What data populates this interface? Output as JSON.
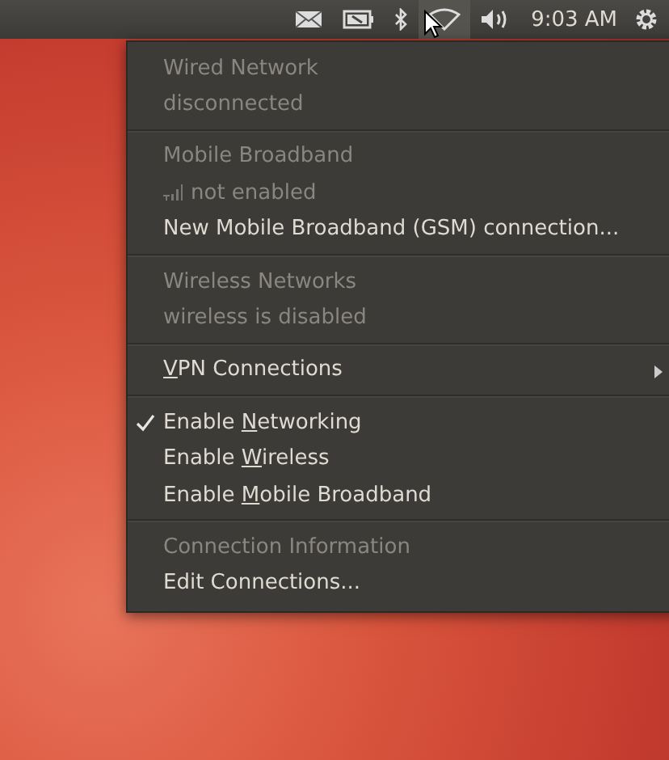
{
  "panel": {
    "indicators": [
      {
        "kind": "mail",
        "selected": false
      },
      {
        "kind": "battery",
        "selected": false
      },
      {
        "kind": "bluetooth",
        "selected": false
      },
      {
        "kind": "wifi",
        "selected": true
      },
      {
        "kind": "volume",
        "selected": false
      }
    ],
    "clock": "9:03 AM"
  },
  "menu": [
    {
      "kind": "label",
      "label": [
        "Wired Network"
      ]
    },
    {
      "kind": "label",
      "label": [
        "disconnected"
      ]
    },
    {
      "kind": "separator"
    },
    {
      "kind": "label",
      "label": [
        "Mobile Broadband"
      ]
    },
    {
      "kind": "signal",
      "label": [
        "not enabled"
      ]
    },
    {
      "kind": "item",
      "label": [
        "New Mobile Broadband (GSM) connection..."
      ]
    },
    {
      "kind": "separator"
    },
    {
      "kind": "label",
      "label": [
        "Wireless Networks"
      ]
    },
    {
      "kind": "label",
      "label": [
        "wireless is disabled"
      ]
    },
    {
      "kind": "separator"
    },
    {
      "kind": "submenu",
      "label": [
        "V",
        "PN Connections"
      ],
      "mnemonic_first": true
    },
    {
      "kind": "separator"
    },
    {
      "kind": "check",
      "checked": true,
      "label": [
        "Enable ",
        "N",
        "etworking"
      ]
    },
    {
      "kind": "check",
      "checked": false,
      "label": [
        "Enable ",
        "W",
        "ireless"
      ]
    },
    {
      "kind": "check",
      "checked": false,
      "label": [
        "Enable ",
        "M",
        "obile Broadband"
      ]
    },
    {
      "kind": "separator"
    },
    {
      "kind": "label",
      "label": [
        "Connection Information"
      ]
    },
    {
      "kind": "item",
      "label": [
        "Edit Connections..."
      ]
    }
  ]
}
